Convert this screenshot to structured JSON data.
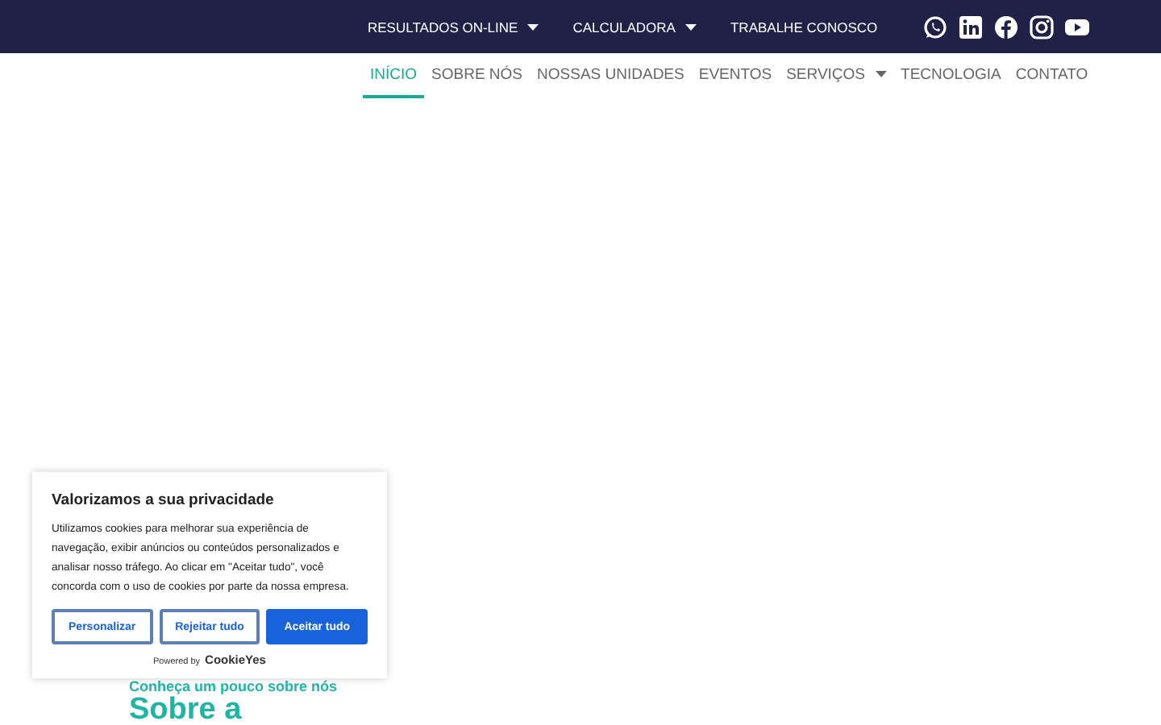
{
  "top_bar": {
    "links": [
      {
        "label": "RESULTADOS ON-LINE",
        "has_dropdown": true
      },
      {
        "label": "CALCULADORA",
        "has_dropdown": true
      },
      {
        "label": "TRABALHE CONOSCO",
        "has_dropdown": false
      }
    ],
    "social": [
      {
        "kind": "whatsapp"
      },
      {
        "kind": "linkedin"
      },
      {
        "kind": "facebook"
      },
      {
        "kind": "instagram"
      },
      {
        "kind": "youtube"
      }
    ]
  },
  "nav": [
    {
      "label": "INÍCIO",
      "selected": true,
      "has_dropdown": false
    },
    {
      "label": "SOBRE NÓS",
      "selected": false,
      "has_dropdown": false
    },
    {
      "label": "NOSSAS UNIDADES",
      "selected": false,
      "has_dropdown": false
    },
    {
      "label": "EVENTOS",
      "selected": false,
      "has_dropdown": false
    },
    {
      "label": "SERVIÇOS",
      "selected": false,
      "has_dropdown": true
    },
    {
      "label": "TECNOLOGIA",
      "selected": false,
      "has_dropdown": false
    },
    {
      "label": "CONTATO",
      "selected": false,
      "has_dropdown": false
    }
  ],
  "about": {
    "kicker": "Conheça um pouco sobre nós",
    "heading": "Sobre a"
  },
  "cookie_banner": {
    "title": "Valorizamos a sua privacidade",
    "text": "Utilizamos cookies para melhorar sua experiência de navegação, exibir anúncios ou conteúdos personalizados e analisar nosso tráfego. Ao clicar em \"Aceitar tudo\", você concorda com o uso de cookies por parte da nossa empresa.",
    "buttons": [
      {
        "label": "Personalizar",
        "kind": "outline"
      },
      {
        "label": "Rejeitar tudo",
        "kind": "outline"
      },
      {
        "label": "Aceitar tudo",
        "kind": "primary"
      }
    ],
    "powered_by": "Powered by",
    "brand": "CookieYes"
  }
}
